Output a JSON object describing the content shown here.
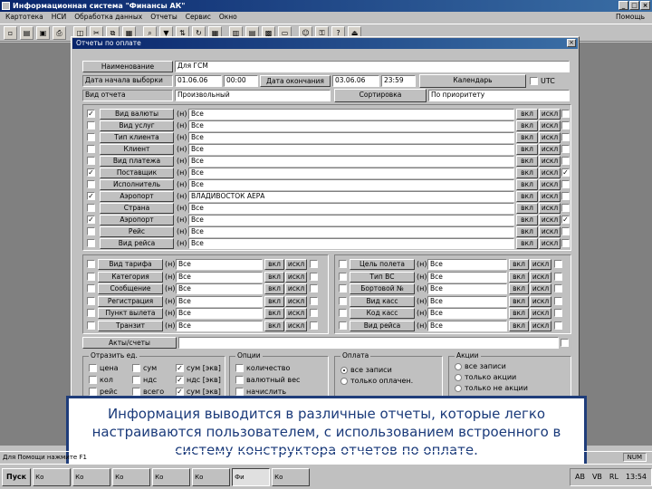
{
  "window": {
    "title": "Информационная система \"Финансы АК\""
  },
  "menu": [
    "Картотека",
    "НСИ",
    "Обработка данных",
    "Отчеты",
    "Сервис",
    "Окно"
  ],
  "menu_right": "Помощь",
  "toolbar_icons": [
    "new-icon",
    "open-icon",
    "save-icon",
    "print-icon",
    "preview-icon",
    "cut-icon",
    "copy-icon",
    "paste-icon",
    "find-icon",
    "filter-icon",
    "sort-icon",
    "refresh-icon",
    "grid-icon",
    "chart-icon",
    "report-icon",
    "calc-icon",
    "folder-icon",
    "user-icon",
    "key-icon",
    "help-icon",
    "exit-icon"
  ],
  "dialog": {
    "title": "Отчеты по оплате",
    "name_label": "Наименование",
    "name_value": "Для ГСМ",
    "start_label": "Дата начала выборки",
    "start_date": "01.06.06",
    "start_time": "00:00",
    "end_label": "Дата окончания",
    "end_date": "03.06.06",
    "end_time": "23:59",
    "calendar_button": "Календарь",
    "utc_label": "UTC",
    "report_type_label": "Вид отчета",
    "report_type_value": "Произвольный",
    "sort_button": "Сортировка",
    "sort_value": "По приоритету",
    "filters": [
      {
        "label": "Вид валюты",
        "checked": true,
        "value": "Все",
        "end": false
      },
      {
        "label": "Вид услуг",
        "checked": false,
        "value": "Все",
        "end": false
      },
      {
        "label": "Тип клиента",
        "checked": false,
        "value": "Все",
        "end": false
      },
      {
        "label": "Клиент",
        "checked": false,
        "value": "Все",
        "end": false
      },
      {
        "label": "Вид платежа",
        "checked": false,
        "value": "Все",
        "end": false
      },
      {
        "label": "Поставщик",
        "checked": true,
        "value": "Все",
        "end": true
      },
      {
        "label": "Исполнитель",
        "checked": false,
        "value": "Все",
        "end": false
      },
      {
        "label": "Аэропорт",
        "checked": true,
        "value": "ВЛАДИВОСТОК АЕРА",
        "end": false
      },
      {
        "label": "Страна",
        "checked": false,
        "value": "Все",
        "end": false
      },
      {
        "label": "Аэропорт",
        "checked": true,
        "value": "Все",
        "end": true
      },
      {
        "label": "Рейс",
        "checked": false,
        "value": "Все",
        "end": false
      },
      {
        "label": "Вид рейса",
        "checked": false,
        "value": "Все",
        "end": false
      }
    ],
    "mark": "(н)",
    "incl": "вкл",
    "excl": "искл",
    "left_filters": [
      {
        "label": "Вид тарифа",
        "value": "Все"
      },
      {
        "label": "Категория",
        "value": "Все"
      },
      {
        "label": "Сообщение",
        "value": "Все"
      },
      {
        "label": "Регистрация",
        "value": "Все"
      },
      {
        "label": "Пункт вылета",
        "value": "Все"
      },
      {
        "label": "Транзит",
        "value": "Все"
      }
    ],
    "right_filters": [
      {
        "label": "Цель полета",
        "value": "Все"
      },
      {
        "label": "Тип ВС",
        "value": "Все"
      },
      {
        "label": "Бортовой №",
        "value": "Все"
      },
      {
        "label": "Вид касс",
        "value": "Все"
      },
      {
        "label": "Код касс",
        "value": "Все"
      },
      {
        "label": "Вид рейса",
        "value": "Все"
      }
    ],
    "act_button": "Акты/счеты",
    "group1": {
      "title": "Отразить ед.",
      "items": [
        {
          "label": "цена",
          "checked": false
        },
        {
          "label": "кол",
          "checked": false
        },
        {
          "label": "рейс",
          "checked": false
        },
        {
          "label": "сум",
          "checked": false
        },
        {
          "label": "ндс",
          "checked": false
        },
        {
          "label": "всего",
          "checked": false
        },
        {
          "label": "сум [экв]",
          "checked": true
        },
        {
          "label": "ндс [экв]",
          "checked": true
        },
        {
          "label": "сум [экв]",
          "checked": true
        }
      ]
    },
    "group2": {
      "title": "Опции",
      "items": [
        "количество",
        "валютный вес",
        "начислить"
      ]
    },
    "group3": {
      "title": "Оплата",
      "items": [
        {
          "label": "все записи",
          "on": true
        },
        {
          "label": "только оплачен.",
          "on": false
        }
      ]
    },
    "group4": {
      "title": "Акции",
      "items": [
        {
          "label": "все записи",
          "on": false
        },
        {
          "label": "только акции",
          "on": false
        },
        {
          "label": "только не акции",
          "on": false
        }
      ]
    }
  },
  "caption": "Информация выводится в различные отчеты, которые легко настраиваются пользователем, с использованием встроенного в систему конструктора отчетов по оплате.",
  "status": {
    "text": "Для Помощи нажмите F1",
    "num": "NUM"
  },
  "taskbar": {
    "start": "Пуск",
    "tasks": [
      "Ко",
      "Ко",
      "Ко",
      "Ко",
      "Ко",
      "Фи",
      "Ко"
    ],
    "tray": [
      "AB",
      "VB",
      "RL",
      "13:54"
    ]
  }
}
